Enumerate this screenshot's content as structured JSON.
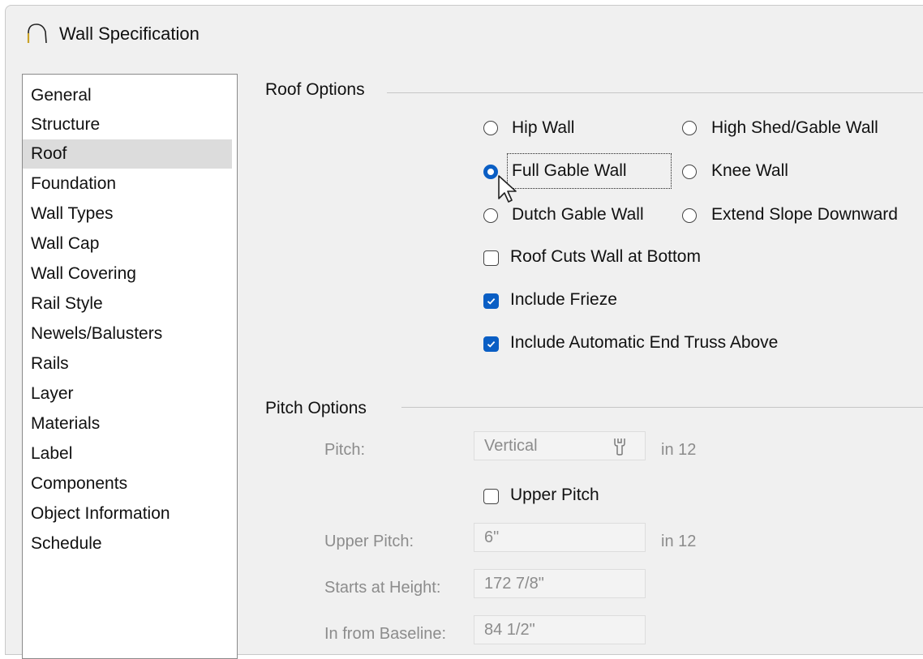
{
  "window": {
    "title": "Wall Specification",
    "icon": "wall-arch-icon"
  },
  "nav": {
    "selected": "Roof",
    "items": [
      {
        "label": "General"
      },
      {
        "label": "Structure"
      },
      {
        "label": "Roof"
      },
      {
        "label": "Foundation"
      },
      {
        "label": "Wall Types"
      },
      {
        "label": "Wall Cap"
      },
      {
        "label": "Wall Covering"
      },
      {
        "label": "Rail Style"
      },
      {
        "label": "Newels/Balusters"
      },
      {
        "label": "Rails"
      },
      {
        "label": "Layer"
      },
      {
        "label": "Materials"
      },
      {
        "label": "Label"
      },
      {
        "label": "Components"
      },
      {
        "label": "Object Information"
      },
      {
        "label": "Schedule"
      }
    ]
  },
  "roof_options": {
    "group_label": "Roof Options",
    "radios": {
      "hip_wall": "Hip Wall",
      "high_shed_gable_wall": "High Shed/Gable Wall",
      "full_gable_wall": "Full Gable Wall",
      "knee_wall": "Knee Wall",
      "dutch_gable_wall": "Dutch Gable Wall",
      "extend_slope_downward": "Extend Slope Downward"
    },
    "selected_radio": "Full Gable Wall",
    "checkboxes": {
      "roof_cuts_wall": {
        "label": "Roof Cuts Wall at Bottom",
        "checked": false
      },
      "include_frieze": {
        "label": "Include Frieze",
        "checked": true
      },
      "include_end_truss": {
        "label": "Include Automatic End Truss Above",
        "checked": true
      }
    }
  },
  "pitch_options": {
    "group_label": "Pitch Options",
    "pitch_label": "Pitch:",
    "pitch_value": "Vertical",
    "pitch_unit": "in 12",
    "upper_pitch_checkbox": {
      "label": "Upper Pitch",
      "checked": false
    },
    "upper_pitch_label": "Upper Pitch:",
    "upper_pitch_value": "6\"",
    "upper_pitch_unit": "in 12",
    "starts_at_height_label": "Starts at Height:",
    "starts_at_height_value": "172 7/8\"",
    "in_from_baseline_label": "In from Baseline:",
    "in_from_baseline_value": "84 1/2\""
  },
  "colors": {
    "accent": "#0a5ec4",
    "selected_bg": "#dcdcdc",
    "disabled_text": "#8c8c8c"
  }
}
